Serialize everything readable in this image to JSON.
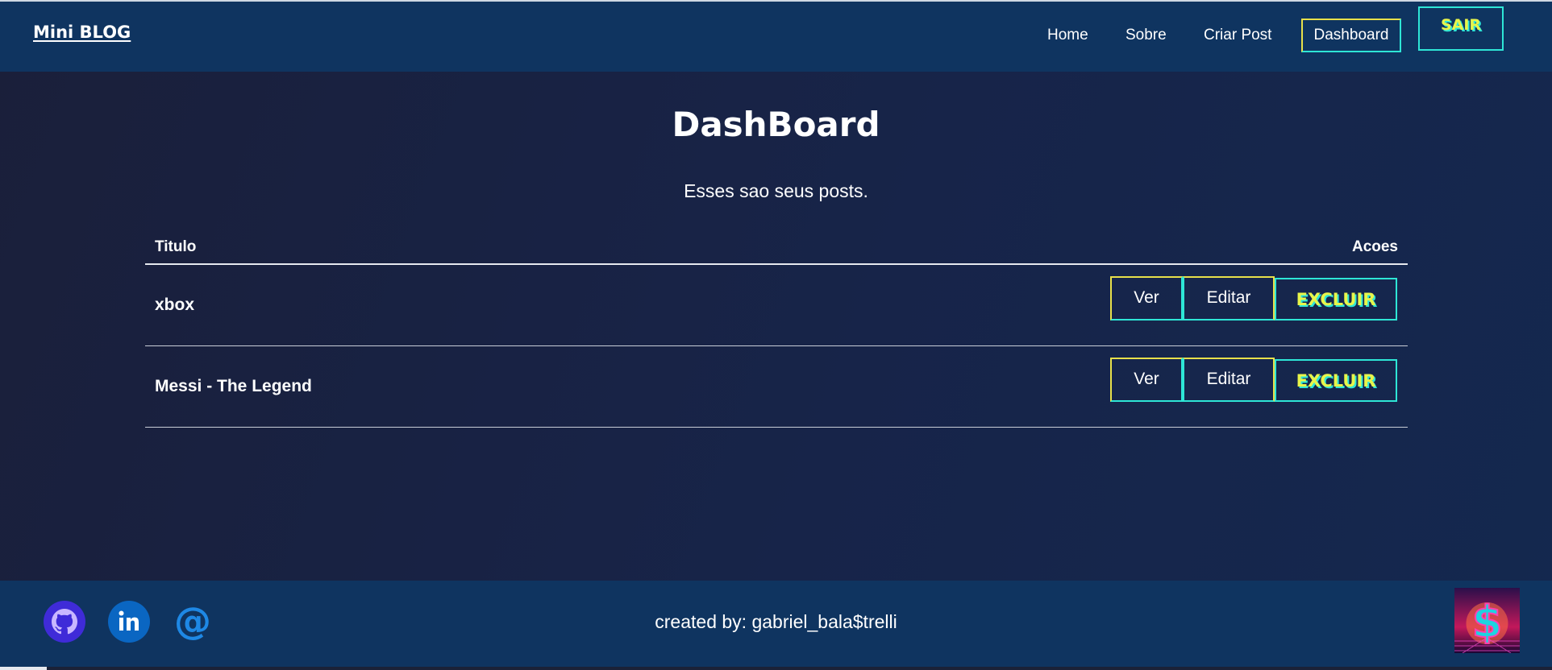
{
  "navbar": {
    "brand": "Mini BLOG",
    "links": {
      "home": "Home",
      "sobre": "Sobre",
      "criar_post": "Criar Post",
      "dashboard": "Dashboard"
    },
    "logout_label": "SAIR"
  },
  "main": {
    "title": "DashBoard",
    "subtitle": "Esses sao seus posts.",
    "table": {
      "headers": {
        "title": "Titulo",
        "actions": "Acoes"
      },
      "rows": [
        {
          "title": "xbox",
          "view_label": "Ver",
          "edit_label": "Editar",
          "delete_label": "EXCLUIR"
        },
        {
          "title": "Messi - The Legend",
          "view_label": "Ver",
          "edit_label": "Editar",
          "delete_label": "EXCLUIR"
        }
      ]
    }
  },
  "footer": {
    "social_icons": [
      "github-icon",
      "linkedin-icon",
      "at-icon"
    ],
    "credit": "created by: gabriel_bala$trelli",
    "logo_icon": "neon-dollar-logo"
  },
  "colors": {
    "navbar_bg": "#0f3460",
    "page_bg": "#172449",
    "accent_yellow": "#e8e04a",
    "accent_cyan": "#2ee6d6",
    "github_purple": "#3f2bd8",
    "linkedin_blue": "#0a66c2",
    "email_blue": "#1e88e5"
  }
}
